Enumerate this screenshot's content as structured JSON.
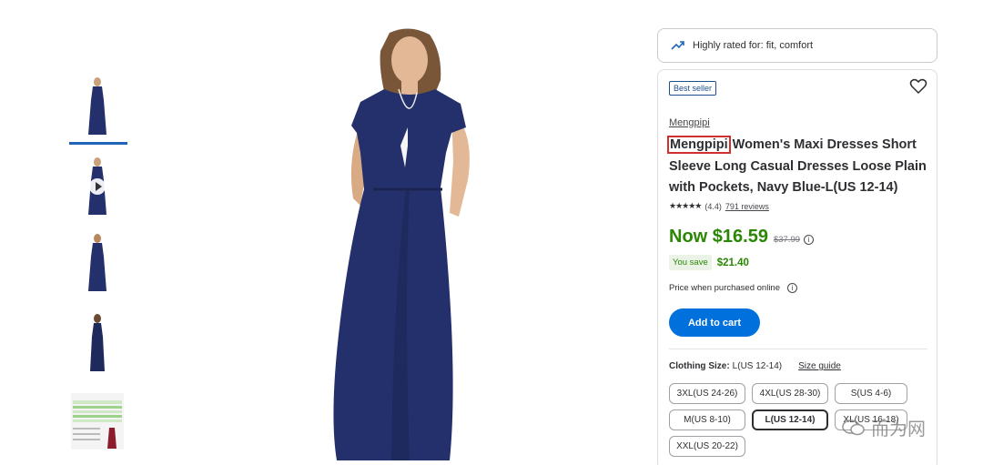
{
  "thumbnails": [
    {
      "kind": "dress",
      "active": true
    },
    {
      "kind": "video"
    },
    {
      "kind": "dress"
    },
    {
      "kind": "dress-side"
    },
    {
      "kind": "size-chart"
    }
  ],
  "highlight": {
    "icon": "trending-up-icon",
    "text": "Highly rated for: fit, comfort"
  },
  "product": {
    "badge": "Best seller",
    "brand": "Mengpipi",
    "title_brand": "Mengpipi",
    "title_rest": " Women's Maxi Dresses Short Sleeve Long Casual Dresses Loose Plain with Pockets, Navy Blue-L(US 12-14)",
    "rating_value": "(4.4)",
    "reviews": "791 reviews",
    "now_price": "Now $16.59",
    "was_price": "$37.99",
    "you_save_label": "You save",
    "you_save_amount": "$21.40",
    "online_note": "Price when purchased online",
    "add_to_cart": "Add to cart"
  },
  "size": {
    "label": "Clothing Size:",
    "value": "L(US 12-14)",
    "guide": "Size guide",
    "options": [
      "3XL(US 24-26)",
      "4XL(US 28-30)",
      "S(US 4-6)",
      "M(US 8-10)",
      "L(US 12-14)",
      "XL(US 16-18)",
      "XXL(US 20-22)"
    ],
    "selected": "L(US 12-14)"
  },
  "watermark": {
    "text": "而为网"
  },
  "colors": {
    "accent": "#0071dc",
    "price_green": "#2a8703",
    "dress": "#24306b",
    "highlight_box": "#d0312d"
  }
}
